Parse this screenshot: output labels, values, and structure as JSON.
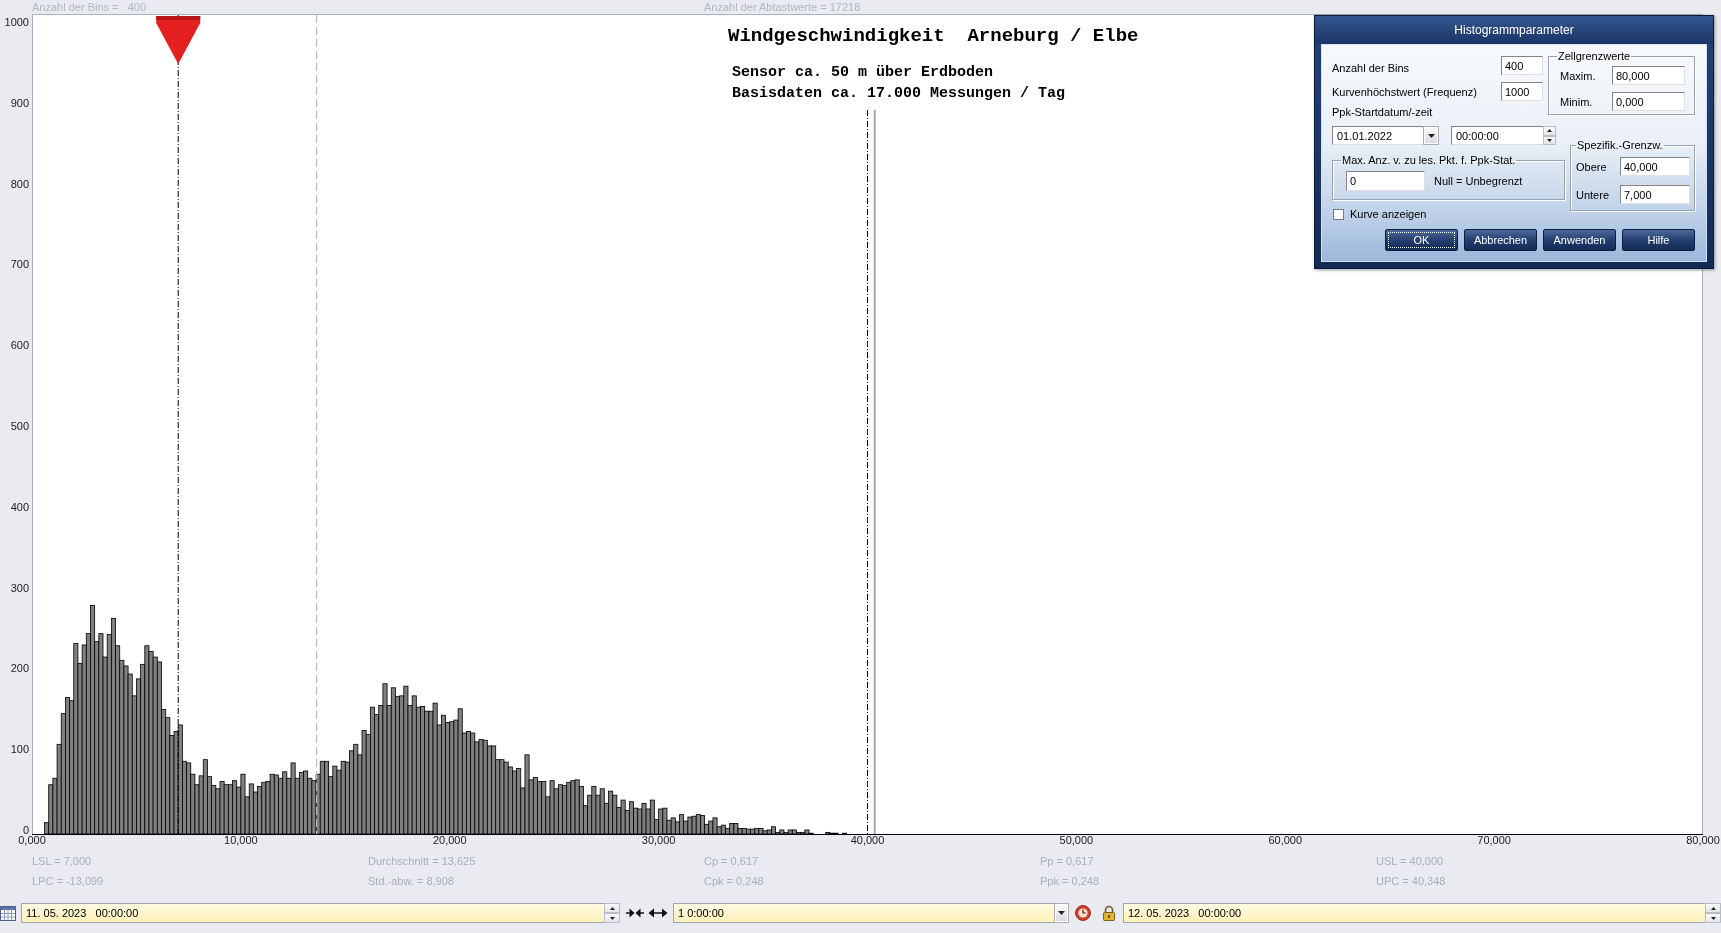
{
  "header": {
    "bins_info": "Anzahl der Bins =   400",
    "samples_info": "Anzahl der Abtastwerte = 17218"
  },
  "chart": {
    "subtitle_lines": [
      "Sensor ca. 50 m über Erdboden",
      "Basisdaten ca. 17.000 Messungen / Tag"
    ],
    "chart_data": {
      "type": "bar",
      "title": "Windgeschwindigkeit  Arneburg / Elbe",
      "xlim": [
        0,
        80
      ],
      "ylim": [
        0,
        1015
      ],
      "xticks": [
        {
          "value": 0,
          "label": "0,000"
        },
        {
          "value": 10,
          "label": "10,000"
        },
        {
          "value": 20,
          "label": "20,000"
        },
        {
          "value": 30,
          "label": "30,000"
        },
        {
          "value": 40,
          "label": "40,000"
        },
        {
          "value": 50,
          "label": "50,000"
        },
        {
          "value": 60,
          "label": "60,000"
        },
        {
          "value": 70,
          "label": "70,000"
        },
        {
          "value": 80,
          "label": "80,000"
        }
      ],
      "yticks": [
        0,
        100,
        200,
        300,
        400,
        500,
        600,
        700,
        800,
        900,
        1000
      ],
      "x": [
        0.7,
        0.9,
        1.1,
        1.3,
        1.5,
        1.7,
        1.9,
        2.1,
        2.3,
        2.5,
        2.7,
        2.9,
        3.1,
        3.3,
        3.5,
        3.7,
        3.9,
        4.1,
        4.3,
        4.5,
        4.7,
        4.9,
        5.1,
        5.3,
        5.5,
        5.7,
        5.9,
        6.1,
        6.3,
        6.5,
        6.7,
        6.9,
        7.1,
        7.3,
        7.5,
        7.7,
        7.9,
        8.1,
        8.3,
        8.5,
        8.7,
        8.9,
        9.1,
        9.3,
        9.5,
        9.7,
        9.9,
        10.1,
        10.3,
        10.5,
        10.7,
        10.9,
        11.1,
        11.3,
        11.5,
        11.7,
        11.9,
        12.1,
        12.3,
        12.5,
        12.7,
        12.9,
        13.1,
        13.3,
        13.5,
        13.7,
        13.9,
        14.1,
        14.3,
        14.5,
        14.7,
        14.9,
        15.1,
        15.3,
        15.5,
        15.7,
        15.9,
        16.1,
        16.3,
        16.5,
        16.7,
        16.9,
        17.1,
        17.3,
        17.5,
        17.7,
        17.9,
        18.1,
        18.3,
        18.5,
        18.7,
        18.9,
        19.1,
        19.3,
        19.5,
        19.7,
        19.9,
        20.1,
        20.3,
        20.5,
        20.7,
        20.9,
        21.1,
        21.3,
        21.5,
        21.7,
        21.9,
        22.1,
        22.3,
        22.5,
        22.7,
        22.9,
        23.1,
        23.3,
        23.5,
        23.7,
        23.9,
        24.1,
        24.3,
        24.5,
        24.7,
        24.9,
        25.1,
        25.3,
        25.5,
        25.7,
        25.9,
        26.1,
        26.3,
        26.5,
        26.7,
        26.9,
        27.1,
        27.3,
        27.5,
        27.7,
        27.9,
        28.1,
        28.3,
        28.5,
        28.7,
        28.9,
        29.1,
        29.3,
        29.5,
        29.7,
        29.9,
        30.1,
        30.3,
        30.5,
        30.7,
        30.9,
        31.1,
        31.3,
        31.5,
        31.7,
        31.9,
        32.1,
        32.3,
        32.5,
        32.7,
        32.9,
        33.1,
        33.3,
        33.5,
        33.7,
        33.9,
        34.1,
        34.3,
        34.5,
        34.7,
        34.9,
        35.1,
        35.3,
        35.5,
        35.7,
        35.9,
        36.1,
        36.3,
        36.5,
        36.7,
        36.9,
        37.1,
        37.3,
        38.1,
        38.3,
        38.5,
        38.9
      ],
      "values": [
        14,
        61,
        69,
        111,
        149,
        169,
        165,
        236,
        211,
        234,
        248,
        283,
        238,
        248,
        219,
        247,
        267,
        233,
        215,
        208,
        198,
        171,
        192,
        210,
        233,
        226,
        219,
        213,
        154,
        144,
        122,
        127,
        135,
        90,
        88,
        74,
        61,
        72,
        92,
        71,
        60,
        56,
        65,
        61,
        61,
        66,
        58,
        74,
        46,
        62,
        52,
        59,
        64,
        65,
        74,
        73,
        69,
        77,
        69,
        88,
        69,
        76,
        78,
        69,
        66,
        74,
        90,
        90,
        71,
        84,
        79,
        90,
        89,
        103,
        111,
        98,
        128,
        123,
        157,
        148,
        159,
        186,
        159,
        181,
        170,
        171,
        183,
        159,
        171,
        157,
        158,
        152,
        152,
        162,
        135,
        147,
        138,
        139,
        141,
        155,
        125,
        127,
        125,
        114,
        117,
        116,
        109,
        109,
        92,
        92,
        89,
        83,
        78,
        81,
        57,
        98,
        67,
        70,
        65,
        65,
        46,
        66,
        56,
        61,
        60,
        64,
        66,
        67,
        59,
        35,
        48,
        59,
        48,
        56,
        38,
        53,
        48,
        33,
        42,
        29,
        40,
        32,
        31,
        38,
        31,
        42,
        18,
        31,
        32,
        17,
        20,
        15,
        24,
        16,
        21,
        22,
        24,
        23,
        12,
        16,
        20,
        9,
        11,
        7,
        13,
        13,
        7,
        7,
        6,
        6,
        7,
        7,
        4,
        5,
        9,
        2,
        5,
        2,
        5,
        5,
        2,
        2,
        5,
        1,
        2,
        1,
        1,
        1
      ],
      "ref_lines": [
        {
          "axis": "x",
          "value": 7
        },
        {
          "axis": "x",
          "value": 13.625
        },
        {
          "axis": "x",
          "value": 40
        },
        {
          "axis": "x",
          "value": 40.348
        }
      ]
    }
  },
  "dialog": {
    "title": "Histogrammparameter",
    "fields": [
      {
        "label": "Anzahl der Bins",
        "value": "400"
      },
      {
        "label": "Kurvenhöchstwert (Frequenz)",
        "value": "1000"
      }
    ],
    "cell_limits": {
      "title": "Zellgrenzwerte",
      "fields": [
        {
          "label": "Maxim.",
          "value": "80,000"
        },
        {
          "label": "Minim.",
          "value": "0,000"
        }
      ]
    },
    "ppk_start": {
      "label": "Ppk-Startdatum/-zeit",
      "date": "01.01.2022",
      "time": "00:00:00"
    },
    "max_points": {
      "title": "Max. Anz. v. zu les. Pkt. f. Ppk-Stat.",
      "value": "0",
      "note": "Null = Unbegrenzt"
    },
    "spec_limits": {
      "title": "Spezifik.-Grenzw.",
      "fields": [
        {
          "label": "Obere",
          "value": "40,000"
        },
        {
          "label": "Untere",
          "value": "7,000"
        }
      ]
    },
    "show_curve": {
      "label": "Kurve anzeigen",
      "checked": false
    },
    "buttons": [
      {
        "label": "OK",
        "focused": true
      },
      {
        "label": "Abbrechen",
        "focused": false
      },
      {
        "label": "Anwenden",
        "focused": false
      },
      {
        "label": "Hilfe",
        "focused": false
      }
    ]
  },
  "statistics": [
    {
      "cells": [
        "LSL = 7,000",
        "Durchschnitt = 13,625",
        "Cp = 0,617",
        "Pp = 0,617",
        "USL = 40,000"
      ]
    },
    {
      "cells": [
        "LPC = -13,099",
        "Std.-abw. = 8,908",
        "Cpk = 0,248",
        "Ppk = 0,248",
        "UPC = 40,348"
      ]
    }
  ],
  "bottom_bar": {
    "start": "11. 05. 2023   00:00:00",
    "interval": "1 0:00:00",
    "end": "12. 05. 2023   00:00:00"
  }
}
